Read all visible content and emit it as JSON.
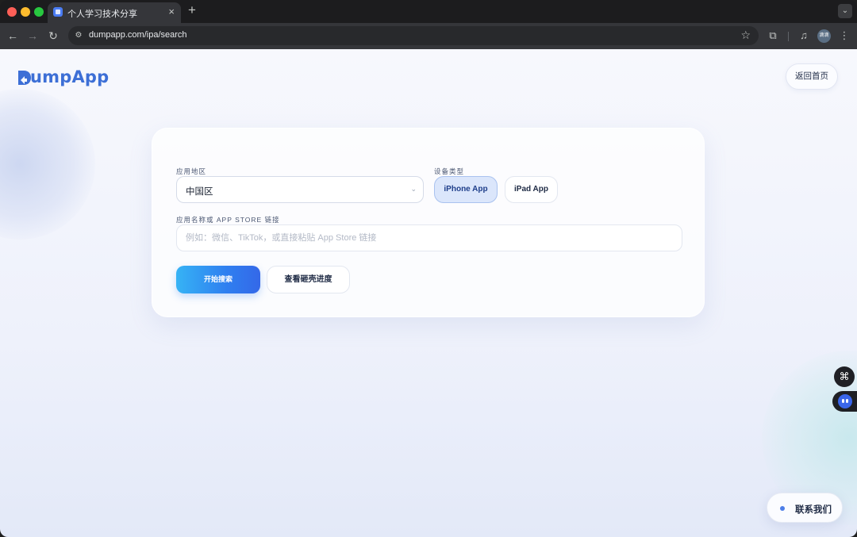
{
  "browser": {
    "tab_title": "个人学习技术分享",
    "new_tab_symbol": "+",
    "close_symbol": "×",
    "url": "dumpapp.com/ipa/search",
    "profile_initials": "滴滴"
  },
  "header": {
    "logo_text": "umpApp",
    "home_button": "返回首页"
  },
  "form": {
    "region_label": "应用地区",
    "region_value": "中国区",
    "device_label": "设备类型",
    "device_options": [
      "iPhone App",
      "iPad App"
    ],
    "device_selected": "iPhone App",
    "name_label": "应用名称或 APP STORE 链接",
    "name_placeholder": "例如：微信、TikTok，或直接粘贴 App Store 链接",
    "name_value": "",
    "search_button": "开始搜索",
    "progress_button": "查看砸壳进度"
  },
  "floating": {
    "contact_label": "联系我们"
  },
  "colors": {
    "brand": "#3d6fd6",
    "primary_gradient_start": "#36b3f5",
    "primary_gradient_end": "#3468e8",
    "selected_device_bg": "#dbe6fb"
  },
  "icons": {
    "grid": "grid-icon",
    "bot": "bot-icon",
    "back": "arrow-left-icon",
    "forward": "arrow-right-icon",
    "reload": "reload-icon",
    "star": "star-icon",
    "extensions": "puzzle-icon",
    "media": "media-control-icon",
    "menu": "kebab-icon"
  }
}
